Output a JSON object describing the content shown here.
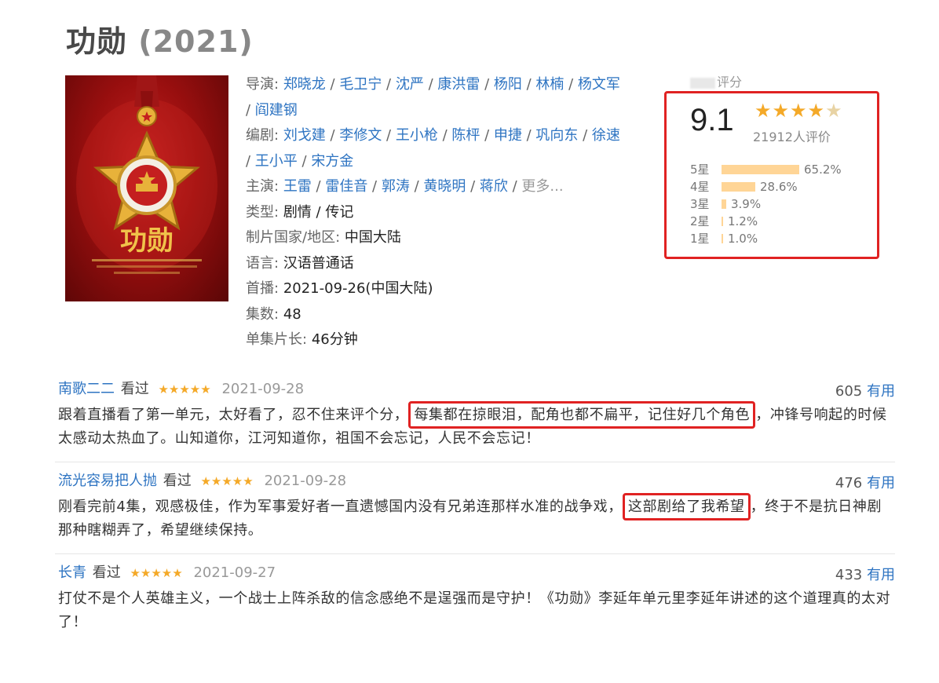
{
  "title": {
    "name": "功勋",
    "year": "(2021)"
  },
  "info": {
    "director_label": "导演:",
    "directors_row1": [
      "郑晓龙",
      "毛卫宁",
      "沈严",
      "康洪雷",
      "杨阳",
      "林楠",
      "杨文军"
    ],
    "directors_row2": [
      "阎建钢"
    ],
    "writer_label": "编剧:",
    "writers_row1": [
      "刘戈建",
      "李修文",
      "王小枪",
      "陈枰",
      "申捷",
      "巩向东",
      "徐速"
    ],
    "writers_row2": [
      "王小平",
      "宋方金"
    ],
    "cast_label": "主演:",
    "cast": [
      "王雷",
      "雷佳音",
      "郭涛",
      "黄晓明",
      "蒋欣"
    ],
    "cast_more": "更多...",
    "genre_label": "类型:",
    "genre": "剧情 / 传记",
    "country_label": "制片国家/地区:",
    "country": "中国大陆",
    "language_label": "语言:",
    "language": "汉语普通话",
    "premiere_label": "首播:",
    "premiere": "2021-09-26(中国大陆)",
    "episodes_label": "集数:",
    "episodes": "48",
    "runtime_label": "单集片长:",
    "runtime": "46分钟"
  },
  "rating": {
    "heading": "评分",
    "score": "9.1",
    "stars": "★★★★",
    "half_star": "★",
    "count": "21912人评价",
    "distribution": [
      {
        "label": "5星",
        "percent": "65.2%",
        "fraction": 0.652
      },
      {
        "label": "4星",
        "percent": "28.6%",
        "fraction": 0.286
      },
      {
        "label": "3星",
        "percent": "3.9%",
        "fraction": 0.039
      },
      {
        "label": "2星",
        "percent": "1.2%",
        "fraction": 0.012
      },
      {
        "label": "1星",
        "percent": "1.0%",
        "fraction": 0.01
      }
    ]
  },
  "reviews": [
    {
      "user": "南歌二二",
      "watched": "看过",
      "stars": "★★★★★",
      "date": "2021-09-28",
      "votes": "605",
      "useful": "有用",
      "pre": "跟着直播看了第一单元，太好看了，忍不住来评个分，",
      "highlight": "每集都在掠眼泪，配角也都不扁平，记住好几个角色",
      "post": "，冲锋号响起的时候太感动太热血了。山知道你，江河知道你，祖国不会忘记，人民不会忘记！"
    },
    {
      "user": "流光容易把人抛",
      "watched": "看过",
      "stars": "★★★★★",
      "date": "2021-09-28",
      "votes": "476",
      "useful": "有用",
      "pre": "刚看完前4集，观感极佳，作为军事爱好者一直遗憾国内没有兄弟连那样水准的战争戏，",
      "highlight": "这部剧给了我希望",
      "post": "，终于不是抗日神剧那种瞎糊弄了，希望继续保持。"
    },
    {
      "user": "长青",
      "watched": "看过",
      "stars": "★★★★★",
      "date": "2021-09-27",
      "votes": "433",
      "useful": "有用",
      "pre": "打仗不是个人英雄主义，一个战士上阵杀敌的信念感绝不是逞强而是守护！《功勋》李延年单元里李延年讲述的这个道理真的太对了！",
      "highlight": "",
      "post": ""
    }
  ],
  "colors": {
    "link": "#2e74c2",
    "star": "#f4a928",
    "bar": "#ffd596",
    "highlight_border": "#e02222"
  },
  "poster": {
    "title_text": "功勋"
  }
}
